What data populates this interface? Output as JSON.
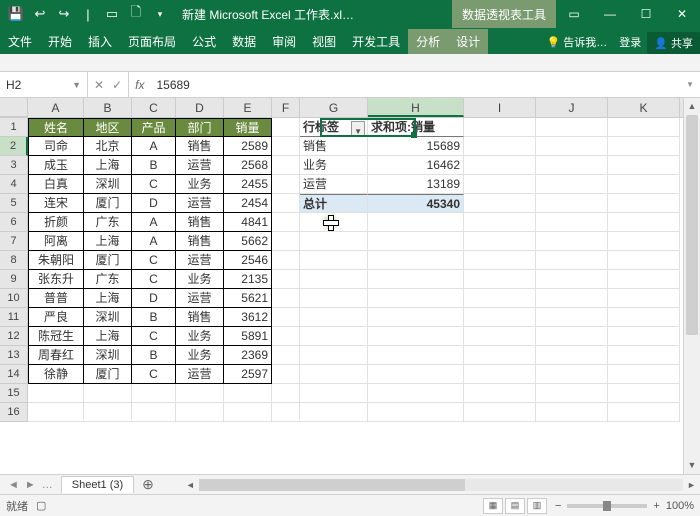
{
  "titlebar": {
    "title": "新建 Microsoft Excel 工作表.xl…",
    "context_tool": "数据透视表工具"
  },
  "ribbon": {
    "tabs": [
      "文件",
      "开始",
      "插入",
      "页面布局",
      "公式",
      "数据",
      "审阅",
      "视图",
      "开发工具"
    ],
    "context_tabs": [
      "分析",
      "设计"
    ],
    "tell_me": "告诉我…",
    "login": "登录",
    "share": "共享"
  },
  "formula": {
    "namebox": "H2",
    "fx": "fx",
    "value": "15689"
  },
  "columns": [
    "A",
    "B",
    "C",
    "D",
    "E",
    "F",
    "G",
    "H",
    "I",
    "J",
    "K"
  ],
  "table": {
    "headers": [
      "姓名",
      "地区",
      "产品",
      "部门",
      "销量"
    ],
    "rows": [
      [
        "司命",
        "北京",
        "A",
        "销售",
        "2589"
      ],
      [
        "成玉",
        "上海",
        "B",
        "运营",
        "2568"
      ],
      [
        "白真",
        "深圳",
        "C",
        "业务",
        "2455"
      ],
      [
        "连宋",
        "厦门",
        "D",
        "运营",
        "2454"
      ],
      [
        "折颜",
        "广东",
        "A",
        "销售",
        "4841"
      ],
      [
        "阿离",
        "上海",
        "A",
        "销售",
        "5662"
      ],
      [
        "朱朝阳",
        "厦门",
        "C",
        "运营",
        "2546"
      ],
      [
        "张东升",
        "广东",
        "C",
        "业务",
        "2135"
      ],
      [
        "普普",
        "上海",
        "D",
        "运营",
        "5621"
      ],
      [
        "严良",
        "深圳",
        "B",
        "销售",
        "3612"
      ],
      [
        "陈冠生",
        "上海",
        "C",
        "业务",
        "5891"
      ],
      [
        "周春红",
        "深圳",
        "B",
        "业务",
        "2369"
      ],
      [
        "徐静",
        "厦门",
        "C",
        "运营",
        "2597"
      ]
    ]
  },
  "pivot": {
    "row_label_header": "行标签",
    "value_header": "求和项:销量",
    "rows": [
      {
        "label": "销售",
        "value": "15689"
      },
      {
        "label": "业务",
        "value": "16462"
      },
      {
        "label": "运营",
        "value": "13189"
      }
    ],
    "total_label": "总计",
    "total_value": "45340"
  },
  "sheet": {
    "active": "Sheet1 (3)"
  },
  "status": {
    "ready": "就绪",
    "zoom": "100%"
  },
  "chart_data": {
    "type": "table",
    "title": "求和项:销量 by 部门",
    "categories": [
      "销售",
      "业务",
      "运营"
    ],
    "values": [
      15689,
      16462,
      13189
    ],
    "total": 45340
  }
}
